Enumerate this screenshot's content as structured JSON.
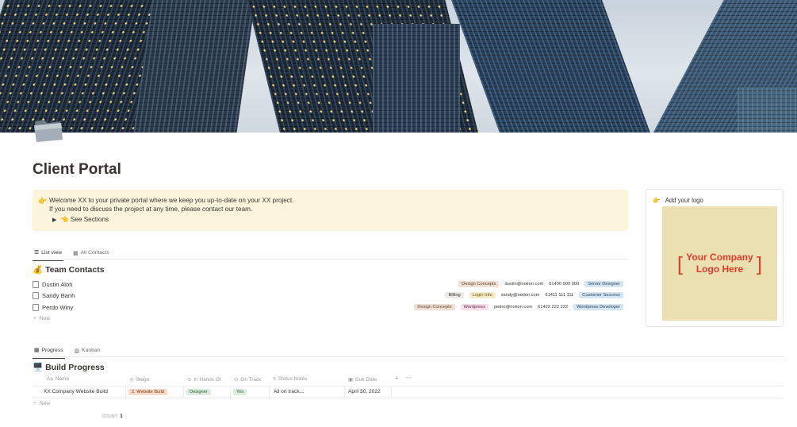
{
  "page": {
    "title": "Client Portal",
    "icon": "folder-icon"
  },
  "callout": {
    "icon": "pointing-hand-icon",
    "line1": "Welcome XX to your private portal where we keep you up-to-date on your XX project.",
    "line2": "If you need to discuss the project at any time, please contact our team.",
    "toggle_label": "👈 See Sections"
  },
  "logo_card": {
    "header": "Add your logo",
    "logo_text_1": "Your Company",
    "logo_text_2": "Logo Here"
  },
  "contacts_view": {
    "tabs": [
      {
        "label": "List view",
        "icon": "list-icon",
        "active": true
      },
      {
        "label": "All Contacts",
        "icon": "table-icon",
        "active": false
      }
    ],
    "title": "Team Contacts",
    "title_emoji": "💰",
    "rows": [
      {
        "name": "Dustin Aloh",
        "tags": [
          "Design Concepts"
        ],
        "email": "dustin@notion.com",
        "phone": "61400 000 000",
        "role": "Senior Designer"
      },
      {
        "name": "Sandy Banh",
        "tags": [
          "Billing",
          "Login Info"
        ],
        "email": "sandy@notion.com",
        "phone": "61411 111 111",
        "role": "Customer Success"
      },
      {
        "name": "Perdo Winy",
        "tags": [
          "Design Concepts",
          "Wordpress"
        ],
        "email": "pedro@notion.com",
        "phone": "61422 222 222",
        "role": "Wordpress Developer"
      }
    ],
    "new_label": "New"
  },
  "progress_view": {
    "tabs": [
      {
        "label": "Progress",
        "icon": "table-icon",
        "active": true
      },
      {
        "label": "Kanban",
        "icon": "board-icon",
        "active": false
      }
    ],
    "title": "Build Progress",
    "title_emoji": "🖥️",
    "columns": [
      "Name",
      "Stage",
      "In Hands Of",
      "On Track",
      "Status Notes",
      "Due Date"
    ],
    "rows": [
      {
        "name": "XX Company Website Build",
        "stage": "2. Website Build",
        "in_hands_of": "Designer",
        "on_track": "Yes",
        "status_notes": "All on track...",
        "due_date": "April 30, 2022"
      }
    ],
    "new_label": "New",
    "count_label": "COUNT",
    "count_value": "1"
  },
  "colors": {
    "callout_bg": "#fbf3db",
    "logo_bg": "#ebe0af",
    "logo_red": "#e03a2f"
  }
}
